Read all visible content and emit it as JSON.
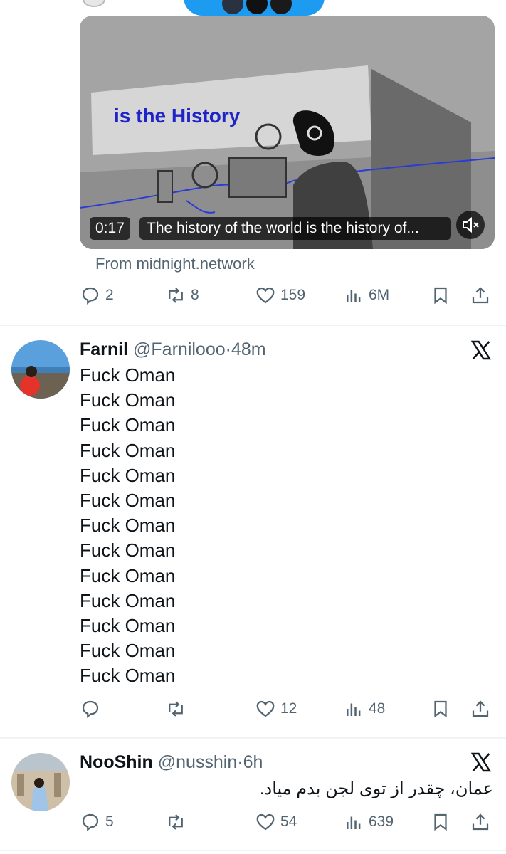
{
  "post1": {
    "video": {
      "banner_text": "is the History",
      "timestamp": "0:17",
      "caption": "The history of the world is the history of..."
    },
    "source": "From midnight.network",
    "actions": {
      "replies": "2",
      "reposts": "8",
      "likes": "159",
      "views": "6M"
    }
  },
  "post2": {
    "name": "Farnil",
    "handle": "@Farnilooo",
    "time": "48m",
    "lines": [
      "Fuck Oman",
      "Fuck Oman",
      "Fuck Oman",
      "Fuck Oman",
      "Fuck Oman",
      "Fuck Oman",
      "Fuck Oman",
      "Fuck Oman",
      "Fuck Oman",
      "Fuck Oman",
      "Fuck Oman",
      "Fuck Oman",
      "Fuck Oman"
    ],
    "actions": {
      "replies": "",
      "reposts": "",
      "likes": "12",
      "views": "48"
    }
  },
  "post3": {
    "name": "NooShin",
    "handle": "@nusshin",
    "time": "6h",
    "text": "عمان، چقدر از توی لجن بدم میاد.",
    "actions": {
      "replies": "5",
      "reposts": "",
      "likes": "54",
      "views": "639"
    }
  },
  "separator": "·",
  "colors": {
    "muted": "#536471",
    "text": "#0f1419",
    "accent": "#1d9bf0",
    "banner_text": "#1f24c8"
  }
}
